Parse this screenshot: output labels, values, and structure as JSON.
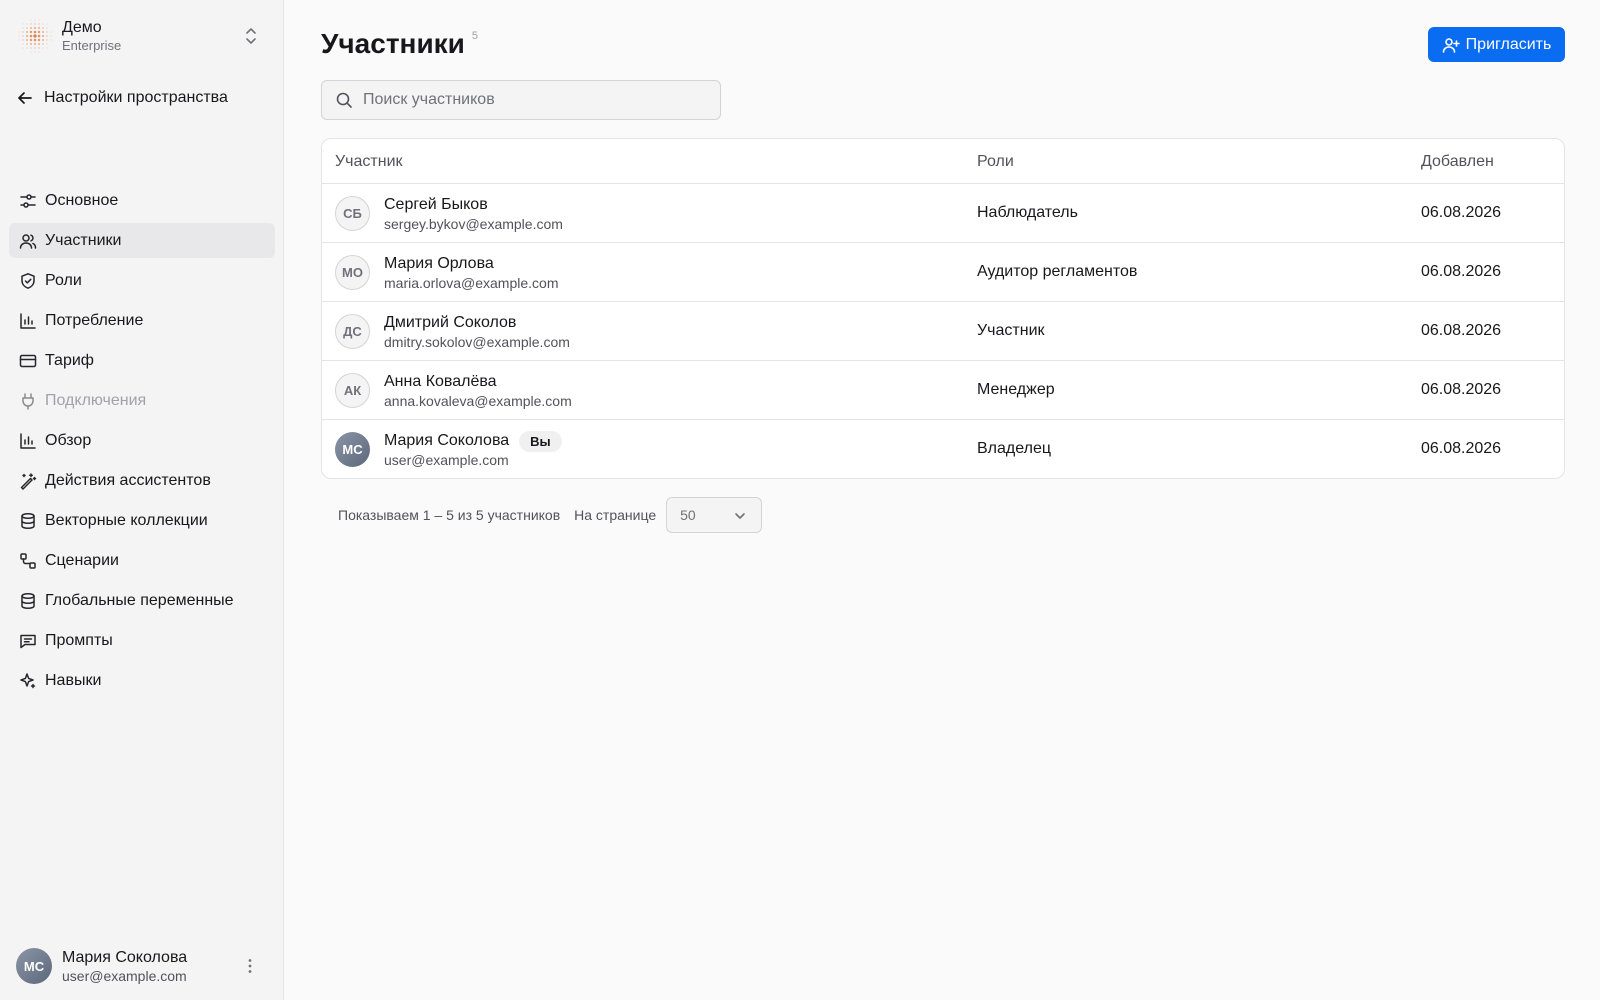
{
  "workspace": {
    "name": "Демо",
    "plan": "Enterprise"
  },
  "back_label": "Настройки пространства",
  "sidebar": {
    "items": [
      {
        "label": "Основное",
        "icon": "sliders-icon"
      },
      {
        "label": "Участники",
        "icon": "users-icon",
        "active": true
      },
      {
        "label": "Роли",
        "icon": "shield-icon"
      },
      {
        "label": "Потребление",
        "icon": "bar-chart-icon"
      },
      {
        "label": "Тариф",
        "icon": "credit-card-icon"
      },
      {
        "label": "Подключения",
        "icon": "plug-icon",
        "disabled": true
      },
      {
        "label": "Обзор",
        "icon": "bar-chart-icon"
      },
      {
        "label": "Действия ассистентов",
        "icon": "magic-wand-icon"
      },
      {
        "label": "Векторные коллекции",
        "icon": "database-icon"
      },
      {
        "label": "Сценарии",
        "icon": "workflow-icon"
      },
      {
        "label": "Глобальные переменные",
        "icon": "database-icon"
      },
      {
        "label": "Промпты",
        "icon": "message-icon"
      },
      {
        "label": "Навыки",
        "icon": "sparkles-icon"
      }
    ]
  },
  "current_user": {
    "initials": "МС",
    "name": "Мария Соколова",
    "email": "user@example.com"
  },
  "page": {
    "title": "Участники",
    "count": "5",
    "invite_label": "Пригласить"
  },
  "search": {
    "placeholder": "Поиск участников",
    "value": ""
  },
  "table": {
    "headers": {
      "member": "Участник",
      "roles": "Роли",
      "added": "Добавлен"
    },
    "rows": [
      {
        "initials": "СБ",
        "name": "Сергей Быков",
        "email": "sergey.bykov@example.com",
        "role": "Наблюдатель",
        "added": "06.08.2026"
      },
      {
        "initials": "МО",
        "name": "Мария Орлова",
        "email": "maria.orlova@example.com",
        "role": "Аудитор регламентов",
        "added": "06.08.2026"
      },
      {
        "initials": "ДС",
        "name": "Дмитрий Соколов",
        "email": "dmitry.sokolov@example.com",
        "role": "Участник",
        "added": "06.08.2026"
      },
      {
        "initials": "АК",
        "name": "Анна Ковалёва",
        "email": "anna.kovaleva@example.com",
        "role": "Менеджер",
        "added": "06.08.2026"
      },
      {
        "initials": "МС",
        "name": "Мария Соколова",
        "you_badge": "Вы",
        "email": "user@example.com",
        "role": "Владелец",
        "added": "06.08.2026"
      }
    ]
  },
  "pagination": {
    "summary": "Показываем 1 – 5 из 5 участников",
    "per_page_label": "На странице",
    "per_page_value": "50"
  },
  "colors": {
    "accent": "#0a6cf0",
    "sidebar_bg": "#f4f4f5",
    "active_item_bg": "#e8e8ea",
    "logo": "#e07b3a"
  }
}
